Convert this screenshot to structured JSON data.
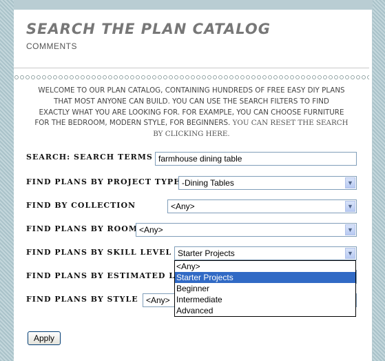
{
  "page": {
    "title": "SEARCH THE PLAN CATALOG",
    "comments": "COMMENTS",
    "intro_line1": "WELCOME TO OUR PLAN CATALOG, CONTAINING HUNDREDS OF FREE EASY DIY PLANS",
    "intro_line2": "THAT MOST ANYONE CAN BUILD. YOU CAN USE THE SEARCH FILTERS TO FIND",
    "intro_line3": "EXACTLY WHAT YOU ARE LOOKING FOR. FOR EXAMPLE, YOU CAN CHOOSE FURNITURE",
    "intro_line4a": "FOR THE BEDROOM, MODERN STYLE, FOR BEGINNERS.",
    "intro_line4b": " YOU CAN RESET THE SEARCH",
    "intro_line5": "BY CLICKING HERE."
  },
  "form": {
    "search_label": "SEARCH: SEARCH TERMS",
    "search_value": "farmhouse dining table",
    "project_type_label": "FIND PLANS BY PROJECT TYPE",
    "project_type_value": "-Dining Tables",
    "collection_label": "FIND BY COLLECTION",
    "collection_value": "<Any>",
    "room_label": "FIND PLANS BY ROOM",
    "room_value": "<Any>",
    "skill_label": "FIND PLANS BY SKILL LEVEL",
    "skill_value": "Starter Projects",
    "lumber_label": "FIND PLANS BY ESTIMATED LUM",
    "style_label": "FIND PLANS BY STYLE",
    "style_value": "<Any>",
    "apply_label": "Apply"
  },
  "skill_dropdown": {
    "options": [
      "<Any>",
      "Starter Projects",
      "Beginner",
      "Intermediate",
      "Advanced"
    ],
    "selected_index": 1
  },
  "colors": {
    "selection": "#316ac5",
    "field_border": "#7f9db9",
    "frame": "#b9cdd3"
  }
}
